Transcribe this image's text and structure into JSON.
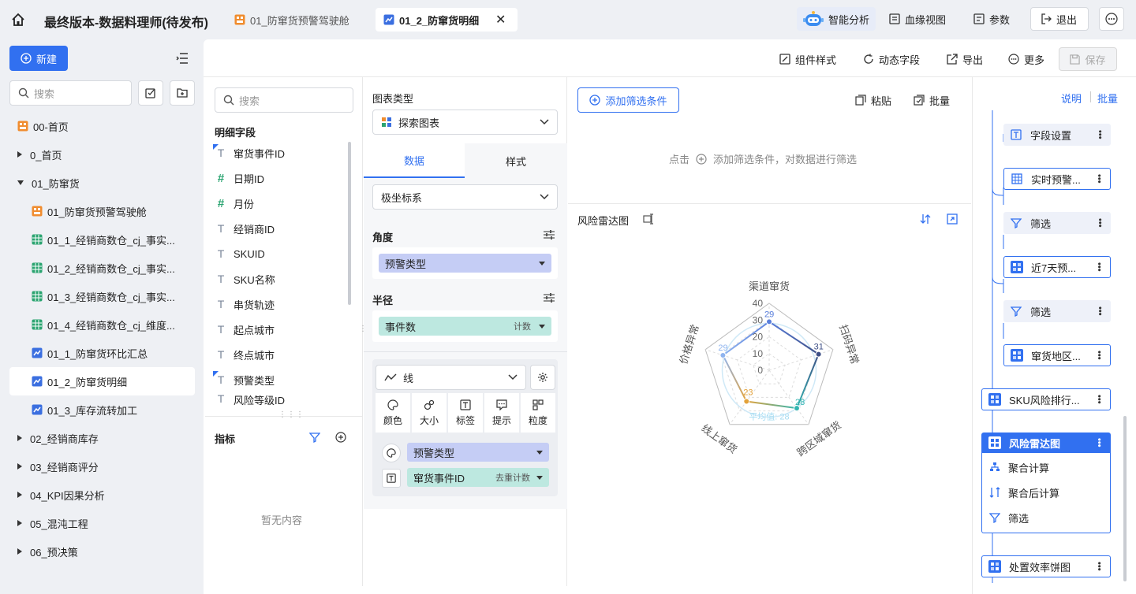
{
  "app": {
    "title": "最终版本-数据料理师(待发布)",
    "tabs": [
      {
        "label": "01_防窜货预警驾驶舱",
        "active": false
      },
      {
        "label": "01_2_防窜货明细",
        "active": true
      }
    ],
    "actions": {
      "ai": "智能分析",
      "lineage": "血缘视图",
      "params": "参数",
      "logout": "退出"
    }
  },
  "sidebar": {
    "new_button": "新建",
    "search_placeholder": "搜索",
    "items": [
      {
        "label": "00-首页",
        "icon": "dashboard-icon",
        "level": 0
      },
      {
        "label": "0_首页",
        "icon": "folder-caret",
        "level": 0,
        "expanded": false
      },
      {
        "label": "01_防窜货",
        "icon": "folder-caret",
        "level": 0,
        "expanded": true
      },
      {
        "label": "01_防窜货预警驾驶舱",
        "icon": "dashboard-icon",
        "level": 1
      },
      {
        "label": "01_1_经销商数仓_cj_事实...",
        "icon": "table-icon",
        "level": 1
      },
      {
        "label": "01_2_经销商数仓_cj_事实...",
        "icon": "table-icon",
        "level": 1
      },
      {
        "label": "01_3_经销商数仓_cj_事实...",
        "icon": "table-icon",
        "level": 1
      },
      {
        "label": "01_4_经销商数仓_cj_维度...",
        "icon": "table-icon",
        "level": 1
      },
      {
        "label": "01_1_防窜货环比汇总",
        "icon": "report-icon",
        "level": 1
      },
      {
        "label": "01_2_防窜货明细",
        "icon": "report-icon",
        "level": 1,
        "selected": true
      },
      {
        "label": "01_3_库存流转加工",
        "icon": "report-icon",
        "level": 1
      },
      {
        "label": "02_经销商库存",
        "icon": "folder-caret",
        "level": 0,
        "expanded": false
      },
      {
        "label": "03_经销商评分",
        "icon": "folder-caret",
        "level": 0,
        "expanded": false
      },
      {
        "label": "04_KPI因果分析",
        "icon": "folder-caret",
        "level": 0,
        "expanded": false
      },
      {
        "label": "05_混沌工程",
        "icon": "folder-caret",
        "level": 0,
        "expanded": false
      },
      {
        "label": "06_预决策",
        "icon": "folder-caret",
        "level": 0,
        "expanded": false
      }
    ]
  },
  "toolbar": {
    "style": "组件样式",
    "dynamic": "动态字段",
    "export": "导出",
    "more": "更多",
    "save": "保存"
  },
  "fields": {
    "search_placeholder": "搜索",
    "detail_title": "明细字段",
    "items": [
      {
        "label": "窜货事件ID",
        "type": "text-geo"
      },
      {
        "label": "日期ID",
        "type": "number"
      },
      {
        "label": "月份",
        "type": "number"
      },
      {
        "label": "经销商ID",
        "type": "text"
      },
      {
        "label": "SKUID",
        "type": "text"
      },
      {
        "label": "SKU名称",
        "type": "text"
      },
      {
        "label": "串货轨迹",
        "type": "text"
      },
      {
        "label": "起点城市",
        "type": "text"
      },
      {
        "label": "终点城市",
        "type": "text"
      },
      {
        "label": "预警类型",
        "type": "text-geo"
      },
      {
        "label": "风险等级ID",
        "type": "text"
      }
    ],
    "metrics_title": "指标",
    "empty": "暂无内容"
  },
  "config": {
    "chart_type_label": "图表类型",
    "chart_type_value": "探索图表",
    "tab_data": "数据",
    "tab_style": "样式",
    "coord": "极坐标系",
    "angle_label": "角度",
    "angle_pill": "预警类型",
    "radius_label": "半径",
    "radius_pill": "事件数",
    "radius_agg": "计数",
    "mark_type": "线",
    "enc": {
      "color": "颜色",
      "size": "大小",
      "label": "标签",
      "tooltip": "提示",
      "detail": "粒度"
    },
    "color_pill": "预警类型",
    "label_pill": "窜货事件ID",
    "label_agg": "去重计数"
  },
  "filter": {
    "add": "添加筛选条件",
    "paste": "粘贴",
    "batch": "批量",
    "hint_prefix": "点击",
    "hint_suffix": "添加筛选条件，对数据进行筛选"
  },
  "chart": {
    "title": "风险雷达图",
    "avg_label": "平均值: 28"
  },
  "chart_data": {
    "type": "radar",
    "categories": [
      "渠道窜货",
      "扫码异常",
      "跨区域窜货",
      "线上窜货",
      "价格异常"
    ],
    "values": [
      29,
      31,
      28,
      23,
      29
    ],
    "colors": [
      "#5a7fdc",
      "#3d4f86",
      "#33b5b0",
      "#e3a23a",
      "#8fb4ef"
    ],
    "ticks": [
      0,
      10,
      20,
      30,
      40
    ],
    "rmax": 40,
    "average": 28
  },
  "flow": {
    "top_links": {
      "help": "说明",
      "batch": "批量"
    },
    "nodes": [
      {
        "label": "字段设置",
        "icon": "field-settings-icon"
      },
      {
        "label": "实时预警...",
        "icon": "table-icon"
      },
      {
        "label": "筛选",
        "icon": "filter-icon"
      },
      {
        "label": "近7天预...",
        "icon": "chart-block-icon"
      },
      {
        "label": "筛选",
        "icon": "filter-icon"
      },
      {
        "label": "窜货地区...",
        "icon": "chart-block-icon"
      },
      {
        "label": "SKU风险排行...",
        "icon": "chart-block-icon"
      },
      {
        "label": "风险雷达图",
        "icon": "chart-block-icon"
      },
      {
        "label": "处置效率饼图",
        "icon": "chart-block-icon"
      }
    ],
    "sub_steps": [
      "聚合计算",
      "聚合后计算",
      "筛选"
    ]
  }
}
